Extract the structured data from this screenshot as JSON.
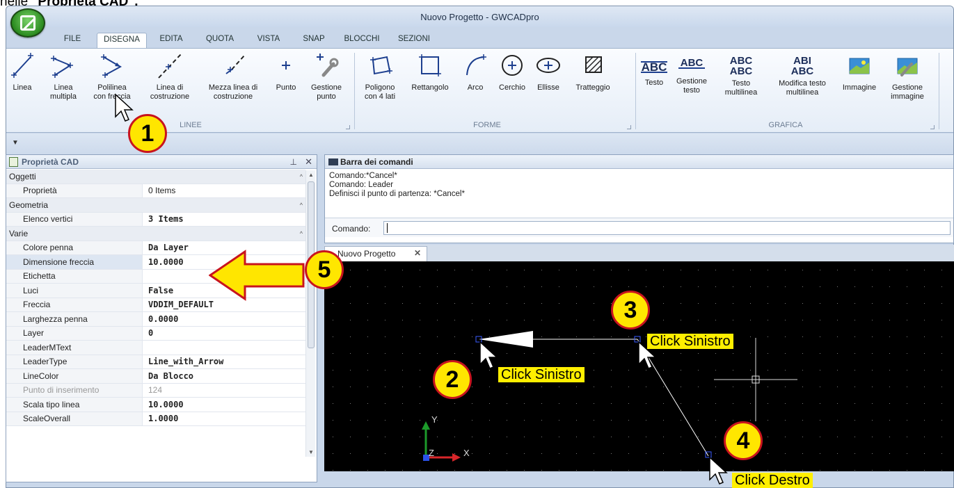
{
  "caption": {
    "prefix": "nelle ",
    "bold": "\"Proprietà CAD\"."
  },
  "window": {
    "title": "Nuovo Progetto - GWCADpro"
  },
  "tabs": [
    "FILE",
    "DISEGNA",
    "EDITA",
    "QUOTA",
    "VISTA",
    "SNAP",
    "BLOCCHI",
    "SEZIONI"
  ],
  "active_tab": "DISEGNA",
  "ribbon": {
    "groups": [
      "LINEE",
      "FORME",
      "GRAFICA"
    ],
    "linee": [
      {
        "l1": "Linea",
        "l2": ""
      },
      {
        "l1": "Linea",
        "l2": "multipla"
      },
      {
        "l1": "Polilinea",
        "l2": "con freccia"
      },
      {
        "l1": "Linea di",
        "l2": "costruzione"
      },
      {
        "l1": "Mezza linea di",
        "l2": "costruzione"
      },
      {
        "l1": "Punto",
        "l2": ""
      },
      {
        "l1": "Gestione",
        "l2": "punto"
      }
    ],
    "forme": [
      {
        "l1": "Poligono",
        "l2": "con 4 lati"
      },
      {
        "l1": "Rettangolo",
        "l2": ""
      },
      {
        "l1": "Arco",
        "l2": ""
      },
      {
        "l1": "Cerchio",
        "l2": ""
      },
      {
        "l1": "Ellisse",
        "l2": ""
      },
      {
        "l1": "Tratteggio",
        "l2": ""
      }
    ],
    "grafica": [
      {
        "l1": "Testo",
        "l2": ""
      },
      {
        "l1": "Gestione",
        "l2": "testo"
      },
      {
        "l1": "Testo",
        "l2": "multilinea"
      },
      {
        "l1": "Modifica testo",
        "l2": "multilinea"
      },
      {
        "l1": "Immagine",
        "l2": ""
      },
      {
        "l1": "Gestione",
        "l2": "immagine"
      }
    ],
    "icon_text": {
      "abc": "ABC",
      "abc2a": "ABC",
      "abc2b": "ABC",
      "ab_mod": "ABI",
      "abc_mod": "ABC"
    }
  },
  "props": {
    "title": "Proprietà CAD",
    "rows": [
      {
        "type": "cat",
        "k": "Oggetti"
      },
      {
        "type": "item",
        "k": "Proprietà",
        "v": "0 Items",
        "bold": false
      },
      {
        "type": "cat",
        "k": "Geometria"
      },
      {
        "type": "item",
        "k": "Elenco vertici",
        "v": "3 Items",
        "bold": true
      },
      {
        "type": "cat",
        "k": "Varie"
      },
      {
        "type": "item",
        "k": "Colore penna",
        "v": "Da Layer",
        "bold": true
      },
      {
        "type": "item",
        "k": "Dimensione freccia",
        "v": "10.0000",
        "bold": true,
        "sel": true
      },
      {
        "type": "item",
        "k": "Etichetta",
        "v": "",
        "bold": false
      },
      {
        "type": "item",
        "k": "Luci",
        "v": "False",
        "bold": true
      },
      {
        "type": "item",
        "k": "Freccia",
        "v": "VDDIM_DEFAULT",
        "bold": true
      },
      {
        "type": "item",
        "k": "Larghezza penna",
        "v": "0.0000",
        "bold": true
      },
      {
        "type": "item",
        "k": "Layer",
        "v": "0",
        "bold": true
      },
      {
        "type": "item",
        "k": "LeaderMText",
        "v": "",
        "bold": false
      },
      {
        "type": "item",
        "k": "LeaderType",
        "v": "Line_with_Arrow",
        "bold": true
      },
      {
        "type": "item",
        "k": "LineColor",
        "v": "Da Blocco",
        "bold": true
      },
      {
        "type": "item",
        "k": "Punto di inserimento",
        "v": "124",
        "bold": false,
        "dim": true
      },
      {
        "type": "item",
        "k": "Scala tipo linea",
        "v": "10.0000",
        "bold": true
      },
      {
        "type": "item",
        "k": "ScaleOverall",
        "v": "1.0000",
        "bold": true
      }
    ]
  },
  "cmd": {
    "title": "Barra dei comandi",
    "lines": [
      "Comando:*Cancel*",
      "Comando: Leader",
      "Definisci il punto di partenza: *Cancel*"
    ],
    "prompt": "Comando:"
  },
  "doc_tab": "Nuovo Progetto",
  "callouts": [
    "1",
    "2",
    "3",
    "4",
    "5"
  ],
  "notes": {
    "n2": "Click Sinistro",
    "n3": "Click Sinistro",
    "n4": "Click Destro"
  },
  "axes": {
    "y": "Y",
    "z": "Z",
    "x": "X"
  },
  "colors": {
    "callout_fill": "#ffe600",
    "callout_border": "#c8141e",
    "note_bg": "#ffef00",
    "canvas_bg": "#000000"
  }
}
